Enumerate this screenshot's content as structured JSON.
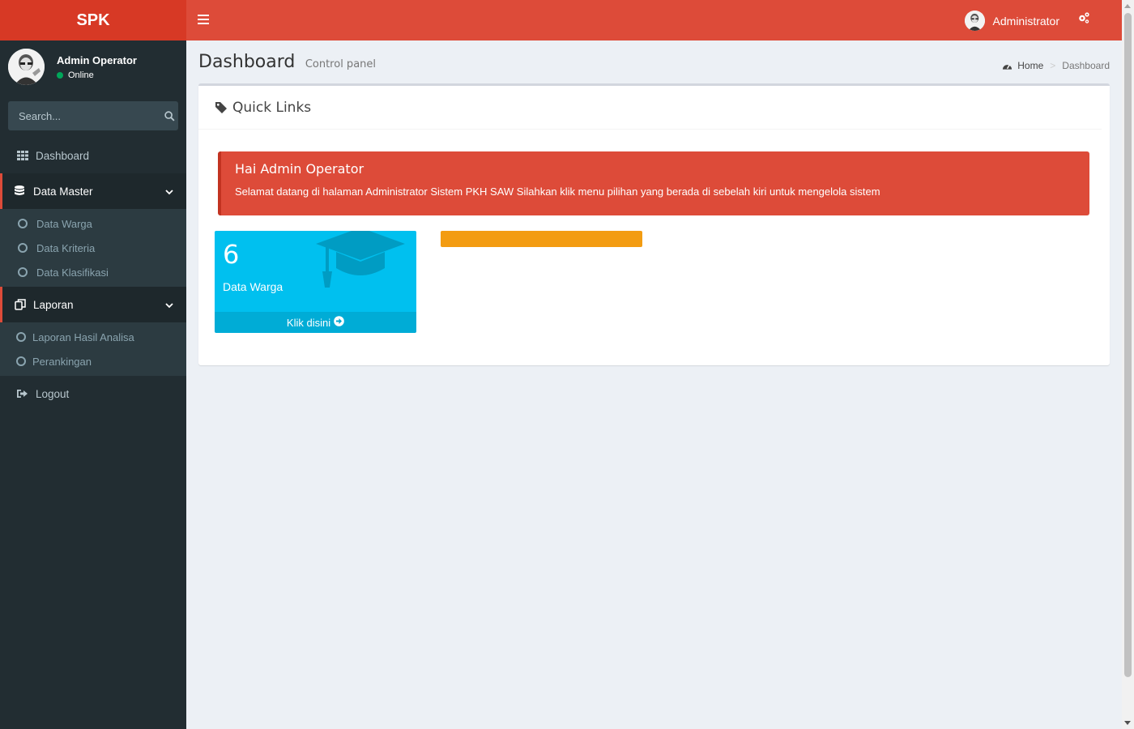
{
  "logo": "SPK",
  "user": {
    "name": "Admin Operator",
    "status": "Online"
  },
  "search": {
    "placeholder": "Search..."
  },
  "menu": {
    "dashboard": "Dashboard",
    "data_master": "Data Master",
    "data_master_items": [
      "Data Warga",
      "Data Kriteria",
      "Data Klasifikasi"
    ],
    "laporan": "Laporan",
    "laporan_items": [
      "Laporan Hasil Analisa",
      "Perankingan"
    ],
    "logout": "Logout"
  },
  "header": {
    "user_label": "Administrator",
    "collapse": "<<"
  },
  "page": {
    "title": "Dashboard",
    "subtitle": "Control panel"
  },
  "breadcrumb": {
    "home": "Home",
    "sep": ">",
    "current": "Dashboard"
  },
  "box": {
    "title": "Quick Links"
  },
  "alert": {
    "title": "Hai Admin Operator",
    "text": "Selamat datang di halaman Administrator Sistem PKH SAW Silahkan klik menu pilihan yang berada di sebelah kiri untuk mengelola sistem"
  },
  "stat": {
    "count": "6",
    "label": "Data Warga",
    "footer": "Klik disini",
    "icon": "graduation-cap-icon"
  },
  "colors": {
    "primary": "#dd4b39",
    "sidebar": "#222d32",
    "info": "#00c0ef",
    "warning": "#f39c12"
  }
}
